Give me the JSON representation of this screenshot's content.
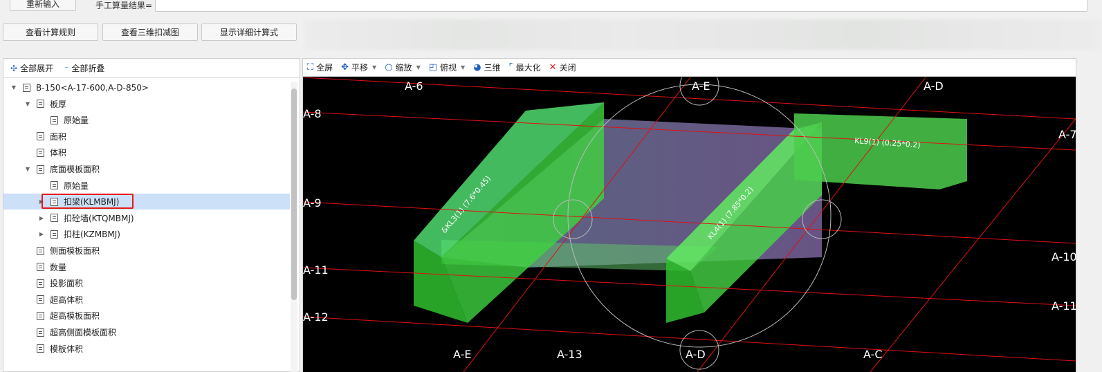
{
  "top": {
    "reinput_label": "重新输入",
    "result_label": "手工算量结果=",
    "result_value": ""
  },
  "actions": {
    "rules_label": "查看计算规则",
    "three_d_label": "查看三维扣减图",
    "details_label": "显示详细计算式"
  },
  "tree_toolbar": {
    "expand_all": "全部展开",
    "collapse_all": "全部折叠"
  },
  "tree": {
    "items": [
      {
        "label": "B-150<A-17-600,A-D-850>",
        "caret": "▼"
      },
      {
        "label": "板厚",
        "caret": "▼"
      },
      {
        "label": "原始量",
        "caret": ""
      },
      {
        "label": "面积",
        "caret": ""
      },
      {
        "label": "体积",
        "caret": ""
      },
      {
        "label": "底面模板面积",
        "caret": "▼"
      },
      {
        "label": "原始量",
        "caret": ""
      },
      {
        "label": "扣梁(KLMBMJ)",
        "caret": "▶"
      },
      {
        "label": "扣砼墙(KTQMBMJ)",
        "caret": "▶"
      },
      {
        "label": "扣柱(KZMBMJ)",
        "caret": "▶"
      },
      {
        "label": "侧面模板面积",
        "caret": ""
      },
      {
        "label": "数量",
        "caret": ""
      },
      {
        "label": "投影面积",
        "caret": ""
      },
      {
        "label": "超高体积",
        "caret": ""
      },
      {
        "label": "超高模板面积",
        "caret": ""
      },
      {
        "label": "超高侧面模板面积",
        "caret": ""
      },
      {
        "label": "模板体积",
        "caret": ""
      }
    ]
  },
  "viewer_toolbar": {
    "fullscreen": "全屏",
    "pan": "平移",
    "zoom": "缩放",
    "top_view": "俯视",
    "three_d": "三维",
    "maximize": "最大化",
    "close": "关闭"
  },
  "scene": {
    "axis_labels": {
      "a6": "A-6",
      "ae_top": "A-E",
      "ad_top": "A-D",
      "a7": "A-7",
      "a8": "A-8",
      "a9": "A-9",
      "a11_left": "A-11",
      "a12": "A-12",
      "a10": "A-10",
      "a11_right": "A-11",
      "ae_bottom": "A-E",
      "a13": "A-13",
      "ad_bottom": "A-D",
      "ac": "A-C"
    },
    "beam_labels": {
      "kl9": "KL9(1) (0.25*0.2)",
      "kl3": "&KL3(1) (7.6*0.45)",
      "kl4": "KL4(1) (7.85*0.2)"
    },
    "colors": {
      "background": "#000000",
      "grid_line": "#e01010",
      "beam": "#4cdd4c",
      "slab": "#8a8aa8"
    }
  }
}
